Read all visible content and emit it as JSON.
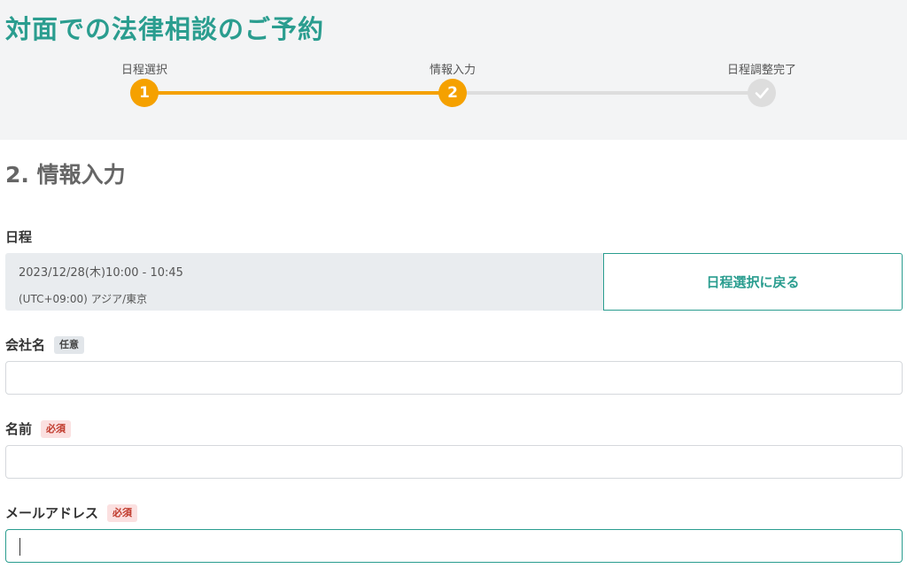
{
  "page": {
    "title": "対面での法律相談のご予約"
  },
  "stepper": {
    "steps": [
      {
        "label": "日程選択",
        "number": "1",
        "state": "done"
      },
      {
        "label": "情報入力",
        "number": "2",
        "state": "current"
      },
      {
        "label": "日程調整完了",
        "number": "",
        "state": "pending",
        "icon": "check-icon"
      }
    ],
    "colors": {
      "active": "#f5a100",
      "pending": "#dddddd"
    }
  },
  "section": {
    "title": "2. 情報入力"
  },
  "schedule": {
    "label": "日程",
    "datetime": "2023/12/28(木)10:00 - 10:45",
    "timezone": "(UTC+09:00) アジア/東京",
    "back_button": "日程選択に戻る"
  },
  "form": {
    "company": {
      "label": "会社名",
      "badge": "任意",
      "value": ""
    },
    "name": {
      "label": "名前",
      "badge": "必須",
      "value": ""
    },
    "email": {
      "label": "メールアドレス",
      "badge": "必須",
      "value": ""
    }
  },
  "colors": {
    "accent": "#2a9d8f",
    "required_badge": "#c0392b",
    "header_bg": "#f3f4f5"
  }
}
